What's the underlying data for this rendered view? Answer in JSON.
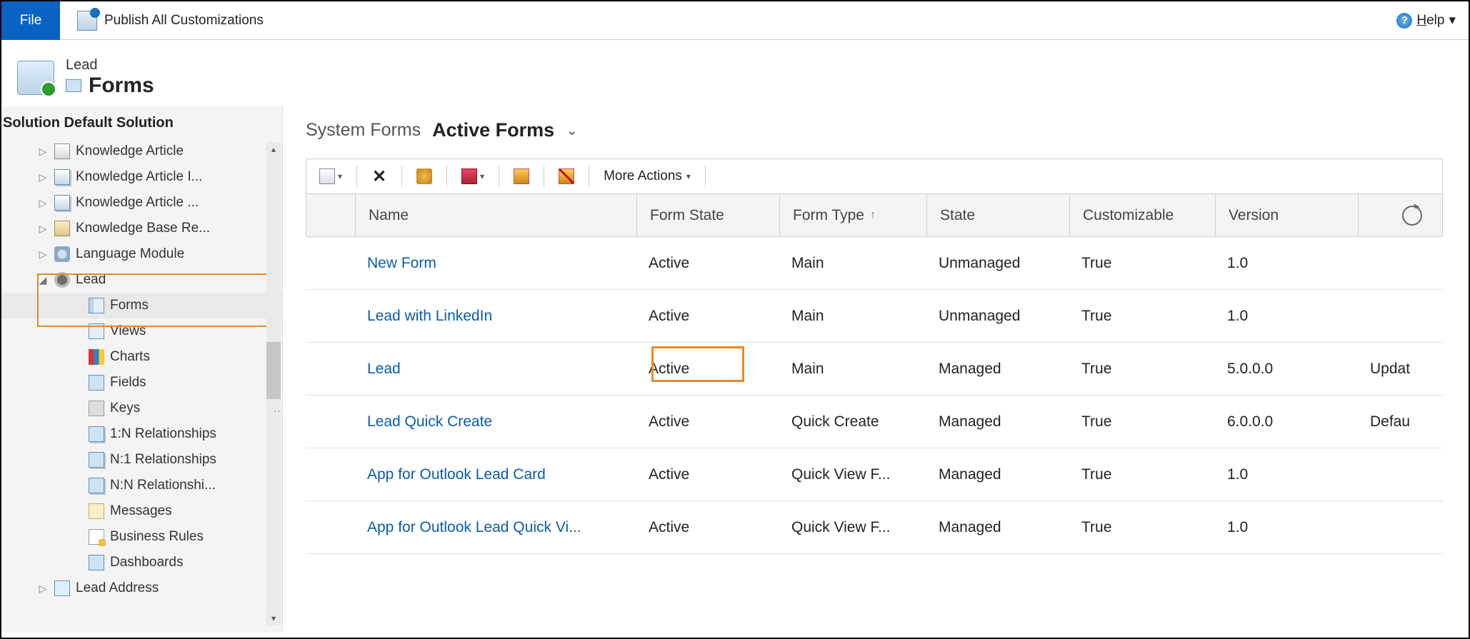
{
  "ribbon": {
    "file_label": "File",
    "publish_label": "Publish All Customizations",
    "help_label": "Help"
  },
  "header": {
    "entity_name": "Lead",
    "section_name": "Forms"
  },
  "sidebar": {
    "solution_label": "Solution Default Solution",
    "items": [
      {
        "label": "Knowledge Article",
        "icon": "doc",
        "caret": "▷"
      },
      {
        "label": "Knowledge Article I...",
        "icon": "docs",
        "caret": "▷"
      },
      {
        "label": "Knowledge Article ...",
        "icon": "docs",
        "caret": "▷"
      },
      {
        "label": "Knowledge Base Re...",
        "icon": "book",
        "caret": "▷"
      },
      {
        "label": "Language Module",
        "icon": "gear",
        "caret": "▷"
      },
      {
        "label": "Lead",
        "icon": "lead",
        "caret": "◢",
        "expanded": true
      }
    ],
    "children": [
      {
        "label": "Forms",
        "icon": "form",
        "selected": true
      },
      {
        "label": "Views",
        "icon": "views"
      },
      {
        "label": "Charts",
        "icon": "chart"
      },
      {
        "label": "Fields",
        "icon": "fields"
      },
      {
        "label": "Keys",
        "icon": "key"
      },
      {
        "label": "1:N Relationships",
        "icon": "rel"
      },
      {
        "label": "N:1 Relationships",
        "icon": "rel"
      },
      {
        "label": "N:N Relationshi...",
        "icon": "rel"
      },
      {
        "label": "Messages",
        "icon": "msg"
      },
      {
        "label": "Business Rules",
        "icon": "br"
      },
      {
        "label": "Dashboards",
        "icon": "dash"
      }
    ],
    "after": {
      "label": "Lead Address",
      "icon": "addr",
      "caret": "▷"
    }
  },
  "content": {
    "view_prefix": "System Forms",
    "view_name": "Active Forms",
    "toolbar": {
      "more_actions": "More Actions"
    },
    "columns": {
      "name": "Name",
      "form_state": "Form State",
      "form_type": "Form Type",
      "state": "State",
      "customizable": "Customizable",
      "version": "Version"
    },
    "rows": [
      {
        "name": "New Form",
        "form_state": "Active",
        "form_type": "Main",
        "state": "Unmanaged",
        "customizable": "True",
        "version": "1.0",
        "desc": ""
      },
      {
        "name": "Lead with LinkedIn",
        "form_state": "Active",
        "form_type": "Main",
        "state": "Unmanaged",
        "customizable": "True",
        "version": "1.0",
        "desc": ""
      },
      {
        "name": "Lead",
        "form_state": "Active",
        "form_type": "Main",
        "state": "Managed",
        "customizable": "True",
        "version": "5.0.0.0",
        "desc": "Updat"
      },
      {
        "name": "Lead Quick Create",
        "form_state": "Active",
        "form_type": "Quick Create",
        "state": "Managed",
        "customizable": "True",
        "version": "6.0.0.0",
        "desc": "Defau"
      },
      {
        "name": "App for Outlook Lead Card",
        "form_state": "Active",
        "form_type": "Quick View F...",
        "state": "Managed",
        "customizable": "True",
        "version": "1.0",
        "desc": ""
      },
      {
        "name": "App for Outlook Lead Quick Vi...",
        "form_state": "Active",
        "form_type": "Quick View F...",
        "state": "Managed",
        "customizable": "True",
        "version": "1.0",
        "desc": ""
      }
    ]
  }
}
